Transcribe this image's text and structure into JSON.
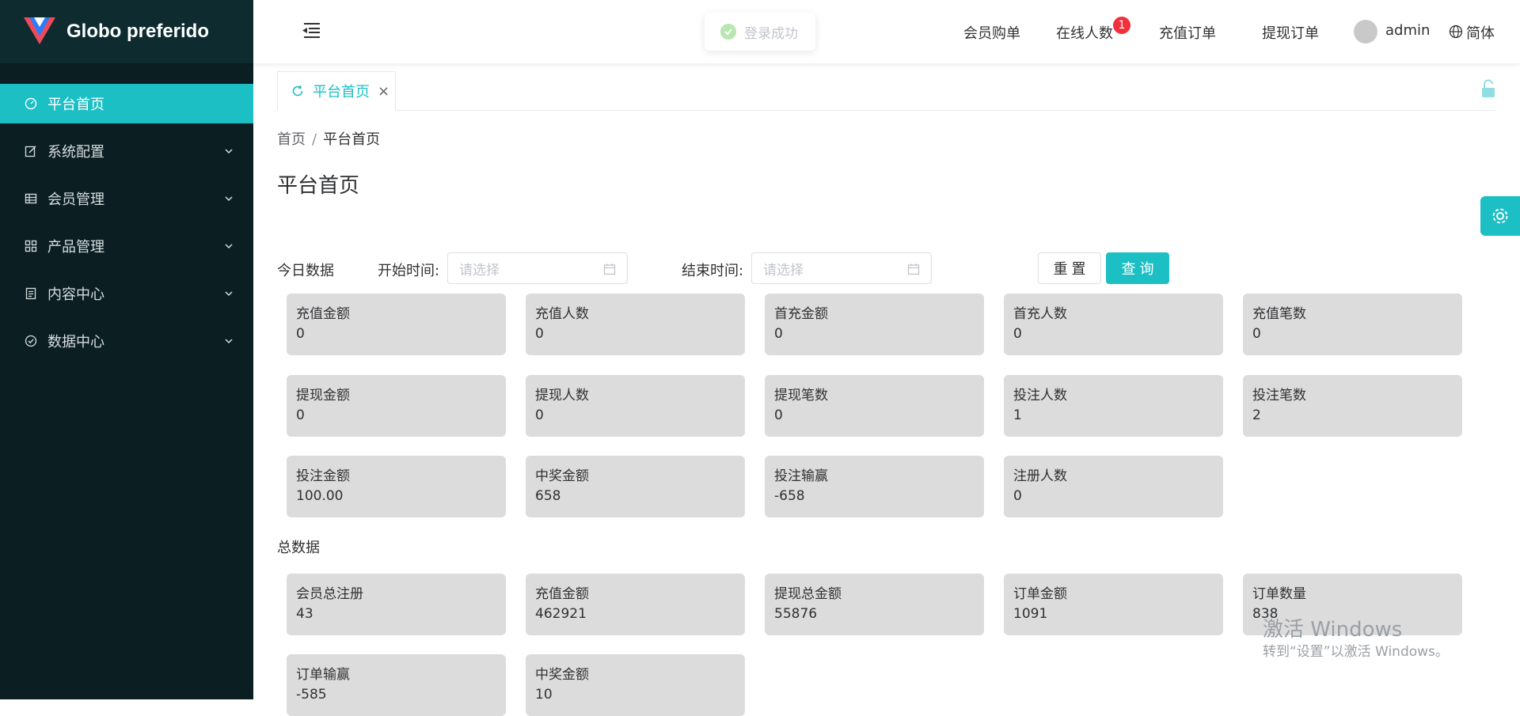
{
  "brand": {
    "title": "Globo preferido",
    "logo_colors": [
      "#f04a5a",
      "#2e7bf6"
    ]
  },
  "sidebar": {
    "items": [
      {
        "label": "平台首页",
        "icon": "dashboard-icon",
        "active": true
      },
      {
        "label": "系统配置",
        "icon": "edit-icon",
        "expandable": true
      },
      {
        "label": "会员管理",
        "icon": "table-icon",
        "expandable": true
      },
      {
        "label": "产品管理",
        "icon": "grid-icon",
        "expandable": true
      },
      {
        "label": "内容中心",
        "icon": "document-icon",
        "expandable": true
      },
      {
        "label": "数据中心",
        "icon": "check-circle-icon",
        "expandable": true
      }
    ]
  },
  "header": {
    "toast": "登录成功",
    "nav": [
      "会员购单",
      "在线人数",
      "充值订单",
      "提现订单"
    ],
    "online_badge": "1",
    "user": "admin",
    "lang": "简体"
  },
  "tabs": {
    "items": [
      {
        "label": "平台首页"
      }
    ]
  },
  "breadcrumb": {
    "home": "首页",
    "sep": "/",
    "current": "平台首页"
  },
  "page": {
    "title": "平台首页"
  },
  "filters": {
    "section_label": "今日数据",
    "start_label": "开始时间:",
    "start_placeholder": "请选择",
    "end_label": "结束时间:",
    "end_placeholder": "请选择",
    "reset": "重 置",
    "query": "查 询"
  },
  "today": [
    {
      "label": "充值金额",
      "value": "0"
    },
    {
      "label": "充值人数",
      "value": "0"
    },
    {
      "label": "首充金额",
      "value": "0"
    },
    {
      "label": "首充人数",
      "value": "0"
    },
    {
      "label": "充值笔数",
      "value": "0"
    },
    {
      "label": "提现金额",
      "value": "0"
    },
    {
      "label": "提现人数",
      "value": "0"
    },
    {
      "label": "提现笔数",
      "value": "0"
    },
    {
      "label": "投注人数",
      "value": "1"
    },
    {
      "label": "投注笔数",
      "value": "2"
    },
    {
      "label": "投注金额",
      "value": "100.00"
    },
    {
      "label": "中奖金额",
      "value": "658"
    },
    {
      "label": "投注输赢",
      "value": "-658"
    },
    {
      "label": "注册人数",
      "value": "0"
    }
  ],
  "total": {
    "section_label": "总数据",
    "cards": [
      {
        "label": "会员总注册",
        "value": "43"
      },
      {
        "label": "充值金额",
        "value": "462921"
      },
      {
        "label": "提现总金额",
        "value": "55876"
      },
      {
        "label": "订单金额",
        "value": "1091"
      },
      {
        "label": "订单数量",
        "value": "838"
      },
      {
        "label": "订单输赢",
        "value": "-585"
      },
      {
        "label": "中奖金额",
        "value": "10"
      }
    ]
  },
  "watermark": {
    "line1": "激活 Windows",
    "line2": "转到“设置”以激活 Windows。"
  },
  "colors": {
    "accent": "#1bbfc4",
    "sidebar_bg": "#0b1f22",
    "card_bg": "#dcdcdc",
    "badge": "#f0313c"
  }
}
